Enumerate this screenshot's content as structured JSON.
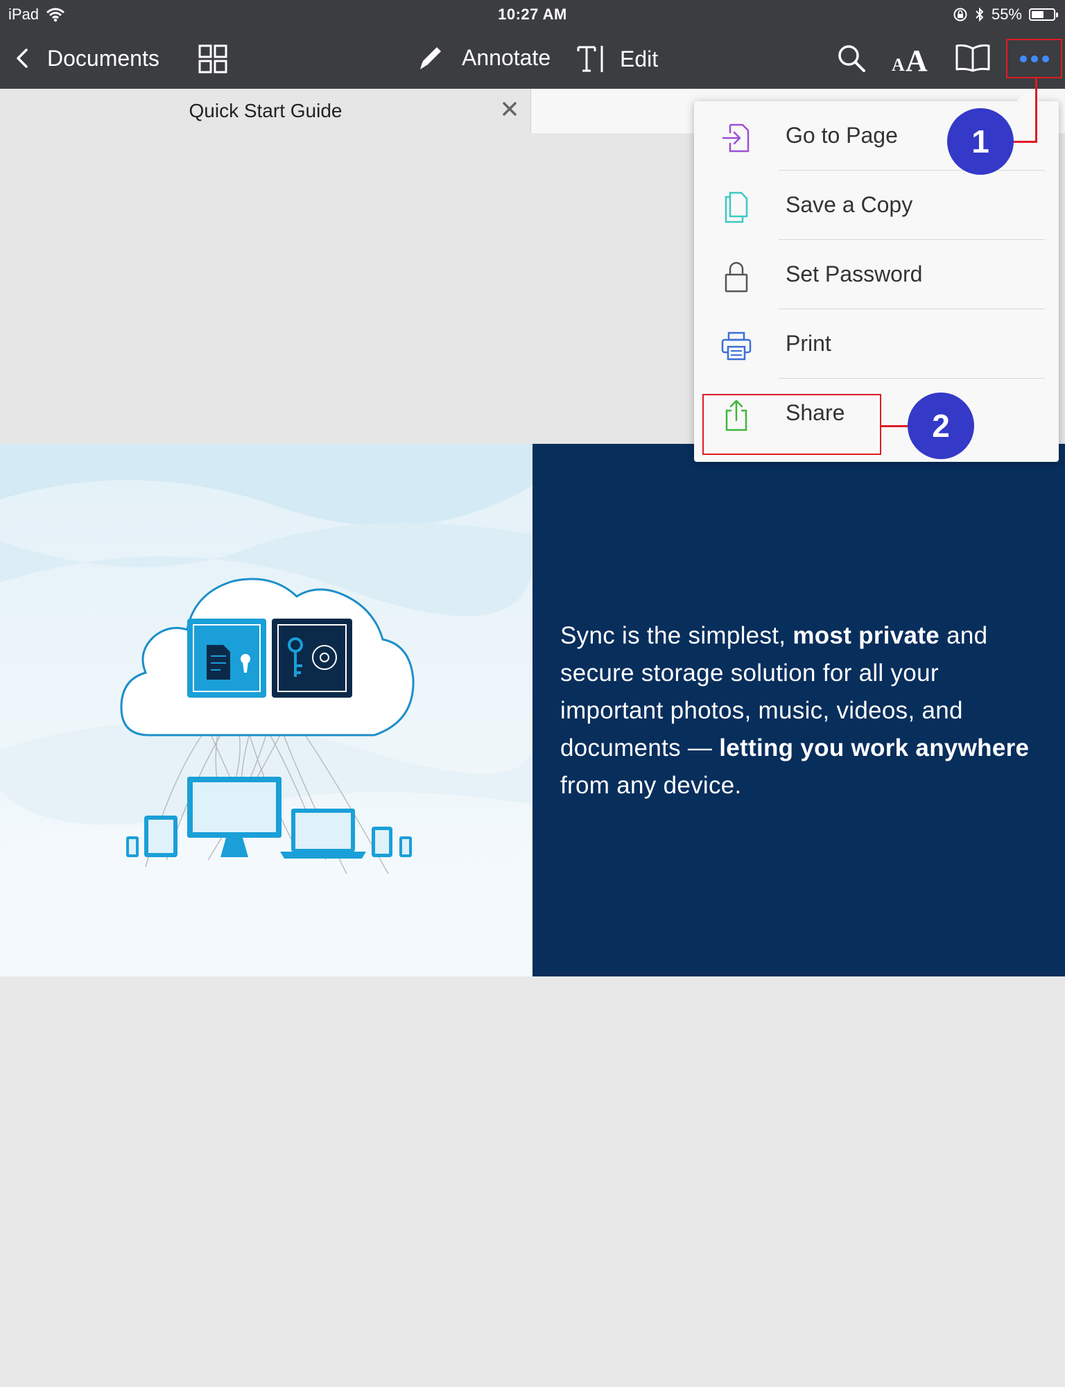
{
  "status_bar": {
    "device": "iPad",
    "time": "10:27 AM",
    "battery": "55%",
    "battery_level": 0.55
  },
  "toolbar": {
    "back_label": "Documents",
    "annotate_label": "Annotate",
    "edit_label": "Edit"
  },
  "tabs": [
    {
      "title": "Quick Start Guide"
    }
  ],
  "menu": {
    "items": [
      {
        "label": "Go to Page",
        "icon": "go-to-page-icon",
        "color": "#9b4fd6"
      },
      {
        "label": "Save a Copy",
        "icon": "copy-icon",
        "color": "#3cc9c4"
      },
      {
        "label": "Set Password",
        "icon": "lock-icon",
        "color": "#555555"
      },
      {
        "label": "Print",
        "icon": "printer-icon",
        "color": "#3a6fd8"
      },
      {
        "label": "Share",
        "icon": "share-icon",
        "color": "#3fb83a"
      }
    ]
  },
  "hero": {
    "text_parts": [
      "Sync is the simplest, ",
      "most private",
      " and secure storage solution for all your important photos, music, videos, and documents — ",
      "letting you work anywhere",
      " from any device."
    ]
  },
  "annotations": {
    "badge_1": "1",
    "badge_2": "2",
    "annotation_color": "#e01b24",
    "badge_color": "#3439c8"
  },
  "colors": {
    "toolbar_bg": "#3b3d40",
    "accent_blue": "#3f8cff",
    "hero_dark": "#082e5c"
  }
}
